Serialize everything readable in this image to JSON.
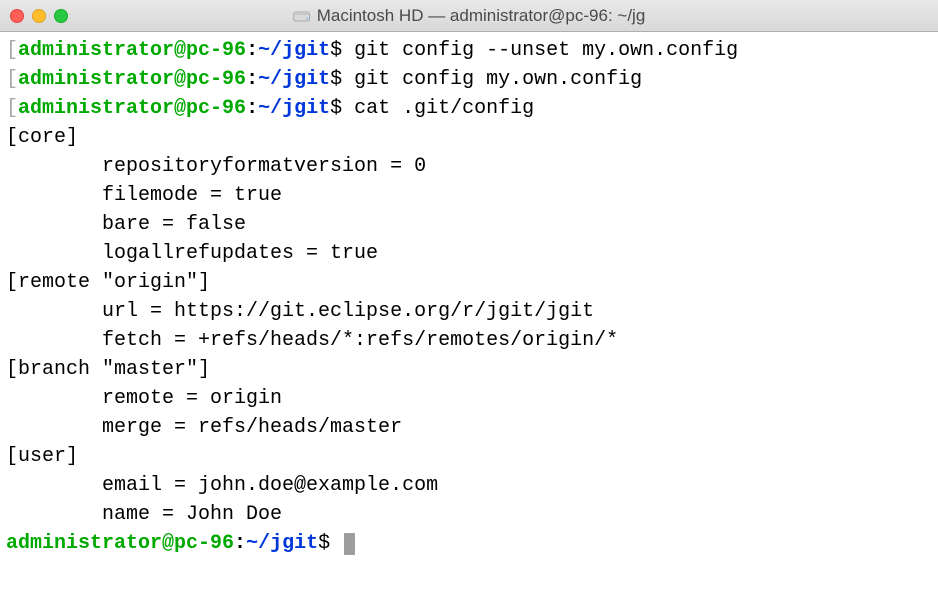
{
  "window": {
    "title": "Macintosh HD — administrator@pc-96: ~/jg"
  },
  "prompt": {
    "bracket_open": "[",
    "user_host": "administrator@pc-96",
    "colon": ":",
    "path": "~/jgit",
    "dollar": "$"
  },
  "history": [
    {
      "cmd": "git config --unset my.own.config",
      "output": []
    },
    {
      "cmd": "git config my.own.config",
      "output": []
    },
    {
      "cmd": "cat .git/config",
      "output": [
        "[core]",
        "        repositoryformatversion = 0",
        "        filemode = true",
        "        bare = false",
        "        logallrefupdates = true",
        "[remote \"origin\"]",
        "        url = https://git.eclipse.org/r/jgit/jgit",
        "        fetch = +refs/heads/*:refs/remotes/origin/*",
        "[branch \"master\"]",
        "        remote = origin",
        "        merge = refs/heads/master",
        "[user]",
        "        email = john.doe@example.com",
        "        name = John Doe"
      ]
    }
  ]
}
